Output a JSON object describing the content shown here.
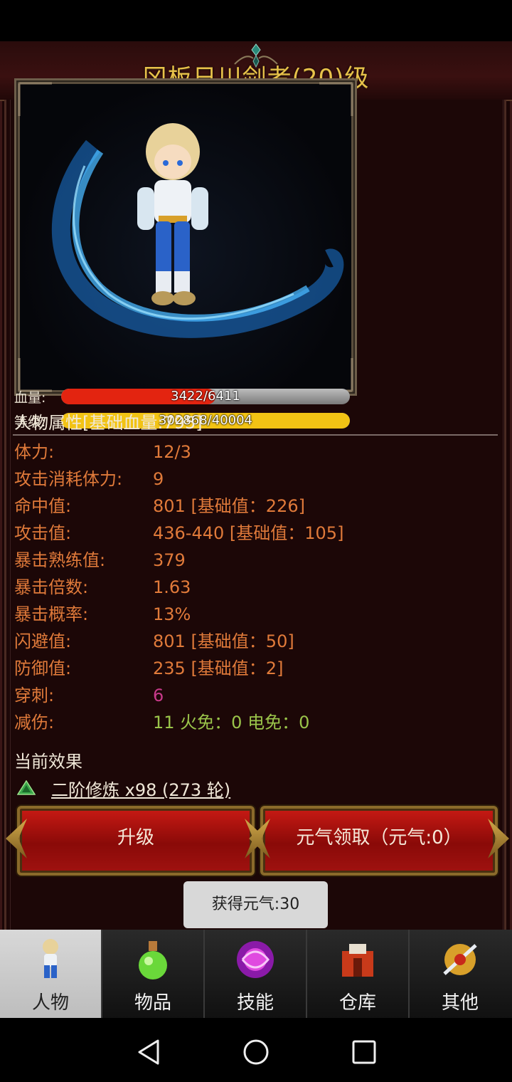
{
  "game": {
    "title": "冈板日川剑者(20)级",
    "hp": {
      "label": "血量:",
      "text": "3422/6411",
      "current": 3422,
      "max": 6411,
      "fill_color": "#e32410"
    },
    "level": {
      "label": "等级:",
      "text": "302868/40004",
      "fill_fraction": 1.0,
      "fill_color": "#f2c314"
    },
    "attributes": {
      "header": "人物属性[基础血量:795]",
      "rows": [
        {
          "label": "体力:",
          "value": "12/3",
          "color": "#e07a3a"
        },
        {
          "label": "攻击消耗体力:",
          "value": "9",
          "color": "#e07a3a"
        },
        {
          "label": "命中值:",
          "value": "801 [基础值：226]",
          "color": "#e07a3a"
        },
        {
          "label": "攻击值:",
          "value": "436-440 [基础值：105]",
          "color": "#e07a3a"
        },
        {
          "label": "暴击熟练值:",
          "value": "379",
          "color": "#e07a3a"
        },
        {
          "label": "暴击倍数:",
          "value": "1.63",
          "color": "#e07a3a"
        },
        {
          "label": "暴击概率:",
          "value": "13%",
          "color": "#e07a3a"
        },
        {
          "label": "闪避值:",
          "value": "801 [基础值：50]",
          "color": "#e07a3a"
        },
        {
          "label": "防御值:",
          "value": "235 [基础值：2]",
          "color": "#e07a3a"
        },
        {
          "label": "穿刺:",
          "value": "6",
          "color": "#c83a8a"
        },
        {
          "label": "减伤:",
          "value": "11 火免：0 电免：0",
          "color": "#9ac44a"
        }
      ]
    },
    "effects": {
      "header": "当前效果",
      "items": [
        {
          "icon": "green-potion-icon",
          "text": "二阶修炼 x98 (273 轮)"
        }
      ]
    },
    "buttons": {
      "upgrade": "升级",
      "claim": "元气领取（元气:0）"
    },
    "toast": "获得元气:30"
  },
  "tabs": [
    {
      "label": "人物",
      "icon": "character-icon",
      "active": true
    },
    {
      "label": "物品",
      "icon": "potion-icon",
      "active": false
    },
    {
      "label": "技能",
      "icon": "skill-orb-icon",
      "active": false
    },
    {
      "label": "仓库",
      "icon": "warehouse-icon",
      "active": false
    },
    {
      "label": "其他",
      "icon": "sword-emblem-icon",
      "active": false
    }
  ],
  "nav": {
    "back": "back-icon",
    "home": "home-icon",
    "recents": "recents-icon"
  }
}
